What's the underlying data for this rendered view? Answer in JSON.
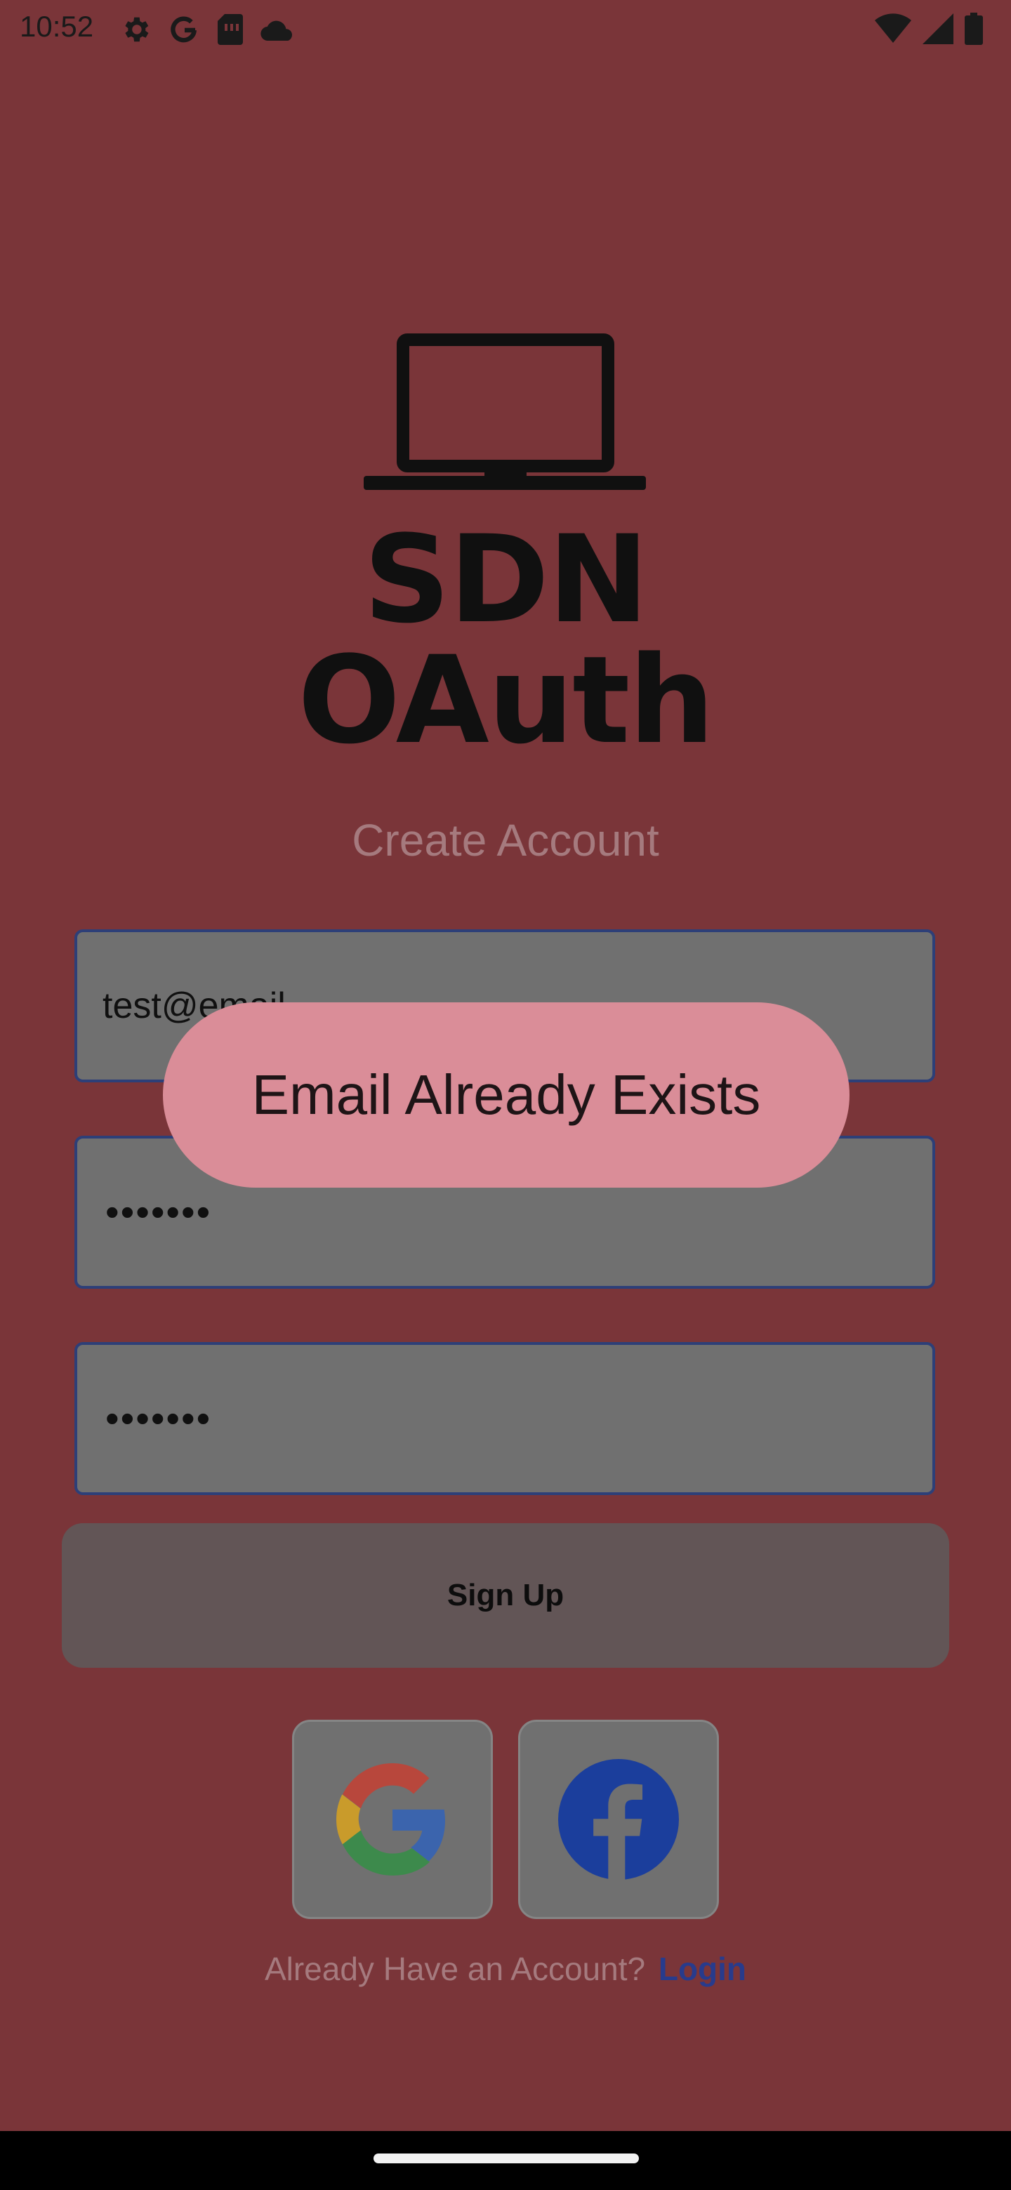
{
  "status_bar": {
    "time": "10:52",
    "left_icons": [
      "gear-icon",
      "google-g-icon",
      "sim-card-icon",
      "cloud-icon"
    ],
    "right_icons": [
      "wifi-icon",
      "cell-signal-icon",
      "battery-icon"
    ]
  },
  "logo": {
    "text": "SDN OAuth",
    "icon": "laptop-icon"
  },
  "heading": "Create Account",
  "form": {
    "email_value": "test@email",
    "password_value": "•••••••",
    "confirm_password_value": "•••••••",
    "signup_label": "Sign Up"
  },
  "social": {
    "google_icon": "google-logo-icon",
    "facebook_icon": "facebook-logo-icon"
  },
  "footer": {
    "prompt": "Already Have an Account?",
    "link": "Login"
  },
  "toast": {
    "message": "Email Already Exists"
  },
  "colors": {
    "background": "#7a3539",
    "field_border": "#2d3f78",
    "toast_bg": "#da8d98",
    "link": "#283b8c"
  }
}
